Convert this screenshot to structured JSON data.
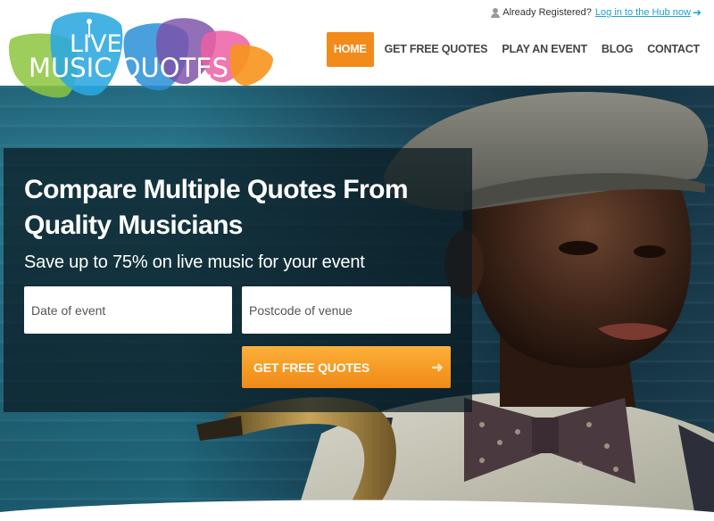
{
  "brand": {
    "logo_line1": "LIVE",
    "logo_line2": "MUSIC QUOTES",
    "colors": {
      "green": "#8cc63f",
      "blue": "#2aa9e0",
      "purple": "#7b4fa8",
      "pink": "#ec5fa4",
      "orange": "#f7941d"
    }
  },
  "login": {
    "prompt": "Already Registered?",
    "link": "Log in to the Hub now",
    "icon": "user-icon",
    "arrow": "➜"
  },
  "nav": {
    "items": [
      {
        "label": "HOME",
        "active": true
      },
      {
        "label": "GET FREE QUOTES",
        "active": false
      },
      {
        "label": "PLAY AN EVENT",
        "active": false
      },
      {
        "label": "BLOG",
        "active": false
      },
      {
        "label": "CONTACT",
        "active": false
      }
    ],
    "active_color": "#f38b1a"
  },
  "hero": {
    "headline": "Compare Multiple Quotes From Quality Musicians",
    "subline": "Save up to 75% on live music for your event",
    "date_placeholder": "Date of event",
    "postcode_placeholder": "Postcode of venue",
    "cta_label": "GET FREE QUOTES",
    "cta_arrow": "➜",
    "cta_color": "#f59a23"
  }
}
